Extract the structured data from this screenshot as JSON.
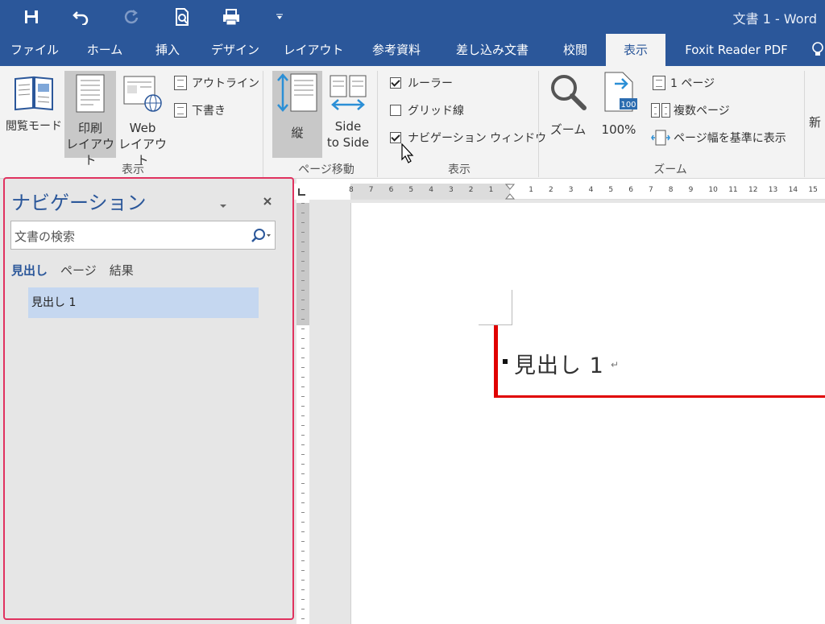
{
  "titlebar": {
    "doc_title": "文書 1  -  Word"
  },
  "tabs": [
    "ファイル",
    "ホーム",
    "挿入",
    "デザイン",
    "レイアウト",
    "参考資料",
    "差し込み文書",
    "校閲",
    "表示",
    "Foxit Reader PDF"
  ],
  "ribbon": {
    "views": {
      "read_mode": "閲覧モード",
      "print_layout_1": "印刷",
      "print_layout_2": "レイアウト",
      "web_layout_1": "Web",
      "web_layout_2": "レイアウト",
      "outline": "アウトライン",
      "draft": "下書き",
      "group_label": "表示"
    },
    "page_movement": {
      "vertical": "縦",
      "side_1": "Side",
      "side_2": "to Side",
      "group_label": "ページ移動"
    },
    "show": {
      "ruler": "ルーラー",
      "gridlines": "グリッド線",
      "nav_pane": "ナビゲーション ウィンドウ",
      "group_label": "表示"
    },
    "zoom": {
      "zoom": "ズーム",
      "hundred": "100%",
      "hundred_badge": "100",
      "one_page": "1 ページ",
      "multiple_pages": "複数ページ",
      "page_width": "ページ幅を基準に表示",
      "group_label": "ズーム"
    },
    "new_window": "新"
  },
  "checkboxes": {
    "ruler": true,
    "gridlines": false,
    "nav_pane": true
  },
  "nav": {
    "title": "ナビゲーション",
    "search_placeholder": "文書の検索",
    "tabs": [
      "見出し",
      "ページ",
      "結果"
    ],
    "headings": [
      "見出し 1"
    ]
  },
  "ruler_numbers": [
    "8",
    "7",
    "6",
    "5",
    "4",
    "3",
    "2",
    "1",
    "",
    "1",
    "2",
    "3",
    "4",
    "5",
    "6",
    "7",
    "8",
    "9",
    "10",
    "11",
    "12",
    "13",
    "14",
    "15"
  ],
  "document": {
    "heading": "見出し 1"
  },
  "colors": {
    "accent": "#2b579a",
    "highlight": "#e0325f",
    "heading_line": "#e00000"
  }
}
